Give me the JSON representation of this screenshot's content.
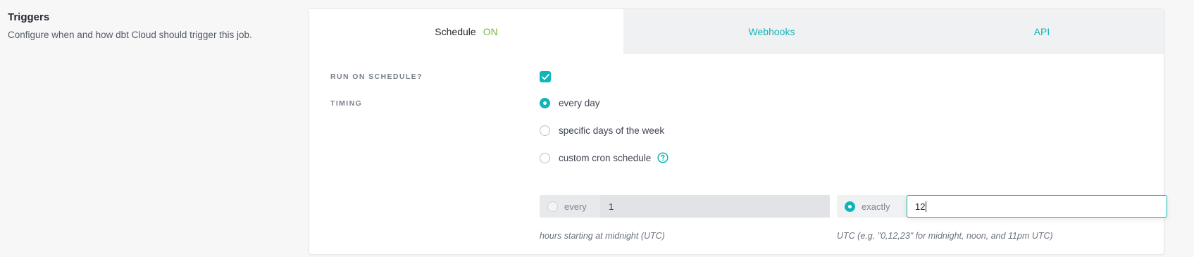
{
  "section": {
    "title": "Triggers",
    "description": "Configure when and how dbt Cloud should trigger this job."
  },
  "tabs": {
    "schedule": "Schedule",
    "schedule_status": "ON",
    "webhooks": "Webhooks",
    "api": "API"
  },
  "form": {
    "run_on_schedule_label": "RUN ON SCHEDULE?",
    "run_on_schedule_checked": true,
    "timing_label": "TIMING",
    "timing_options": [
      "every day",
      "specific days of the week",
      "custom cron schedule"
    ],
    "timing_selected": "every day",
    "every_label": "every",
    "every_value": "1",
    "exactly_label": "exactly",
    "exactly_value": "12",
    "every_hint": "hours starting at midnight (UTC)",
    "exactly_hint": "UTC (e.g. \"0,12,23\" for midnight, noon, and 11pm UTC)"
  },
  "colors": {
    "accent": "#11b5b7",
    "on_status": "#73b839"
  }
}
